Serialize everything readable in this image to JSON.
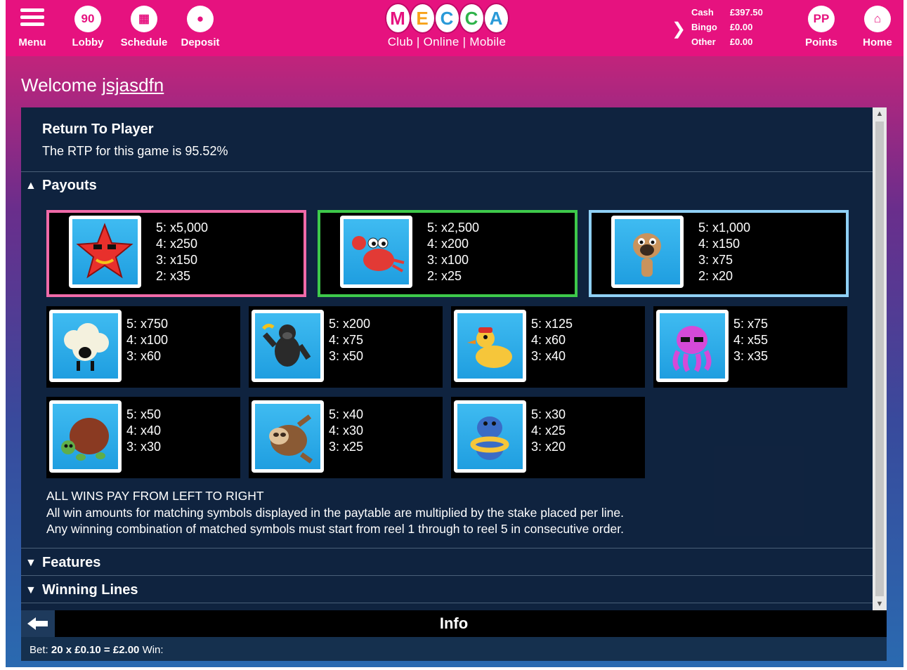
{
  "nav": {
    "menu": "Menu",
    "lobby": "Lobby",
    "schedule": "Schedule",
    "deposit": "Deposit",
    "points": "Points",
    "home": "Home"
  },
  "logo": {
    "letters": [
      "M",
      "E",
      "C",
      "C",
      "A"
    ],
    "tagline": "Club | Online | Mobile"
  },
  "balances": [
    {
      "label": "Cash",
      "value": "£397.50"
    },
    {
      "label": "Bingo",
      "value": "£0.00"
    },
    {
      "label": "Other",
      "value": "£0.00"
    }
  ],
  "welcome": {
    "prefix": "Welcome ",
    "username": "jsjasdfn"
  },
  "rtp": {
    "title": "Return To Player",
    "text": "The RTP for this game is 95.52%"
  },
  "sections": {
    "payouts": "Payouts",
    "features": "Features",
    "winning_lines": "Winning Lines"
  },
  "paytable": {
    "top": [
      {
        "symbol": "starfish",
        "pays": [
          "5: x5,000",
          "4: x250",
          "3: x150",
          "2: x35"
        ]
      },
      {
        "symbol": "crab",
        "pays": [
          "5: x2,500",
          "4: x200",
          "3: x100",
          "2: x25"
        ]
      },
      {
        "symbol": "pug",
        "pays": [
          "5: x1,000",
          "4: x150",
          "3: x75",
          "2: x20"
        ]
      }
    ],
    "middle": [
      {
        "symbol": "sheep",
        "pays": [
          "5: x750",
          "4: x100",
          "3: x60"
        ]
      },
      {
        "symbol": "gorilla",
        "pays": [
          "5: x200",
          "4: x75",
          "3: x50"
        ]
      },
      {
        "symbol": "duck",
        "pays": [
          "5: x125",
          "4: x60",
          "3: x40"
        ]
      },
      {
        "symbol": "octopus",
        "pays": [
          "5: x75",
          "4: x55",
          "3: x35"
        ]
      }
    ],
    "bottom": [
      {
        "symbol": "turtle",
        "pays": [
          "5: x50",
          "4: x40",
          "3: x30"
        ]
      },
      {
        "symbol": "sloth",
        "pays": [
          "5: x40",
          "4: x30",
          "3: x25"
        ]
      },
      {
        "symbol": "hippo",
        "pays": [
          "5: x30",
          "4: x25",
          "3: x20"
        ]
      }
    ]
  },
  "footnote": [
    "ALL WINS PAY FROM LEFT TO RIGHT",
    "All win amounts for matching symbols displayed in the paytable are multiplied by the stake placed per line.",
    "Any winning combination of matched symbols must start from reel 1 through to reel 5 in consecutive order."
  ],
  "info_title": "Info",
  "bet": {
    "label": "Bet:",
    "value": "20 x £0.10 = £2.00",
    "win_label": "Win:"
  },
  "colors": {
    "brand_pink": "#e6127f",
    "panel": "#163252",
    "card_border_starfish": "#f06aa8",
    "card_border_crab": "#3ec94a",
    "card_border_pug": "#8fd0f5"
  }
}
